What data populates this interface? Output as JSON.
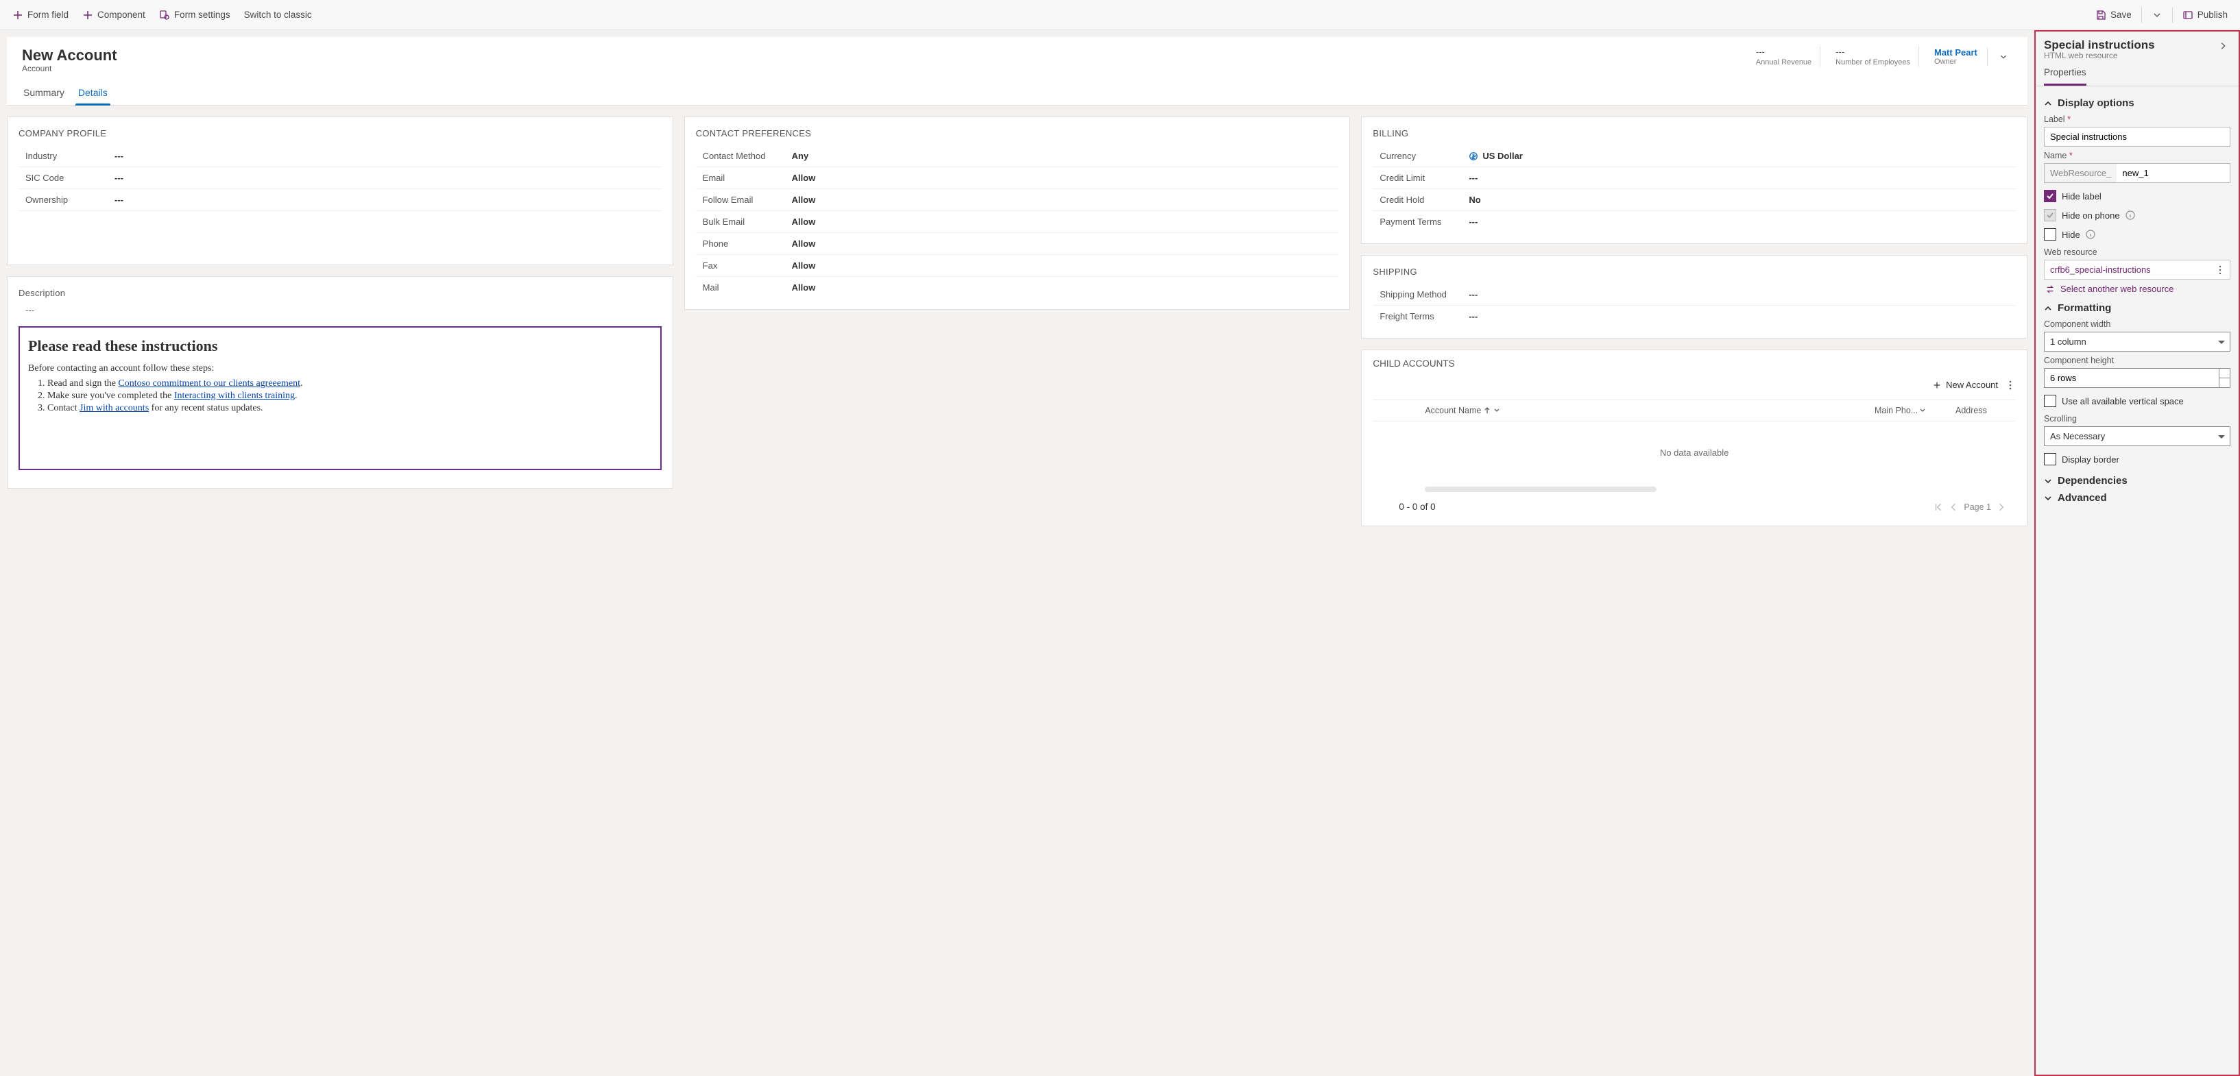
{
  "commandbar": {
    "left": {
      "form_field": "Form field",
      "component": "Component",
      "form_settings": "Form settings",
      "switch_classic": "Switch to classic"
    },
    "right": {
      "save": "Save",
      "publish": "Publish"
    }
  },
  "form_header": {
    "title": "New Account",
    "entity": "Account",
    "stats": [
      {
        "value": "---",
        "label": "Annual Revenue"
      },
      {
        "value": "---",
        "label": "Number of Employees"
      }
    ],
    "owner": {
      "name": "Matt Peart",
      "label": "Owner"
    }
  },
  "tabs": {
    "summary": "Summary",
    "details": "Details"
  },
  "sections": {
    "company_profile": {
      "title": "COMPANY PROFILE",
      "fields": [
        {
          "label": "Industry",
          "value": "---"
        },
        {
          "label": "SIC Code",
          "value": "---"
        },
        {
          "label": "Ownership",
          "value": "---"
        }
      ]
    },
    "description": {
      "title": "Description",
      "value": "---"
    },
    "contact_prefs": {
      "title": "CONTACT PREFERENCES",
      "fields": [
        {
          "label": "Contact Method",
          "value": "Any"
        },
        {
          "label": "Email",
          "value": "Allow"
        },
        {
          "label": "Follow Email",
          "value": "Allow"
        },
        {
          "label": "Bulk Email",
          "value": "Allow"
        },
        {
          "label": "Phone",
          "value": "Allow"
        },
        {
          "label": "Fax",
          "value": "Allow"
        },
        {
          "label": "Mail",
          "value": "Allow"
        }
      ]
    },
    "billing": {
      "title": "BILLING",
      "fields": [
        {
          "label": "Currency",
          "value": "US Dollar"
        },
        {
          "label": "Credit Limit",
          "value": "---"
        },
        {
          "label": "Credit Hold",
          "value": "No"
        },
        {
          "label": "Payment Terms",
          "value": "---"
        }
      ]
    },
    "shipping": {
      "title": "SHIPPING",
      "fields": [
        {
          "label": "Shipping Method",
          "value": "---"
        },
        {
          "label": "Freight Terms",
          "value": "---"
        }
      ]
    },
    "child_accounts": {
      "title": "CHILD ACCOUNTS",
      "add_label": "New Account",
      "col_name": "Account Name",
      "col_phone": "Main Pho...",
      "col_addr": "Address",
      "empty": "No data available",
      "footer_range": "0 - 0 of 0",
      "page": "Page 1"
    }
  },
  "webres": {
    "heading": "Please read these instructions",
    "line": "Before contacting an account follow these steps:",
    "li1_a": "Read and sign the ",
    "li1_link": "Contoso commitment to our clients agreeement",
    "li1_b": ".",
    "li2_a": "Make sure you've completed the ",
    "li2_link": "Interacting with clients training",
    "li2_b": ".",
    "li3_a": "Contact ",
    "li3_link": "Jim with accounts",
    "li3_b": " for any recent status updates."
  },
  "proppane": {
    "title": "Special instructions",
    "sub": "HTML web resource",
    "tab": "Properties",
    "sec_display": "Display options",
    "label_lbl": "Label",
    "label_val": "Special instructions",
    "name_lbl": "Name",
    "name_prefix": "WebResource_",
    "name_val": "new_1",
    "hide_label": "Hide label",
    "hide_phone": "Hide on phone",
    "hide": "Hide",
    "webres_lbl": "Web resource",
    "webres_name": "crfb6_special-instructions",
    "select_another": "Select another web resource",
    "sec_formatting": "Formatting",
    "comp_width_lbl": "Component width",
    "comp_width_val": "1 column",
    "comp_height_lbl": "Component height",
    "comp_height_val": "6 rows",
    "use_all_space": "Use all available vertical space",
    "scrolling_lbl": "Scrolling",
    "scrolling_val": "As Necessary",
    "display_border": "Display border",
    "sec_dependencies": "Dependencies",
    "sec_advanced": "Advanced"
  }
}
